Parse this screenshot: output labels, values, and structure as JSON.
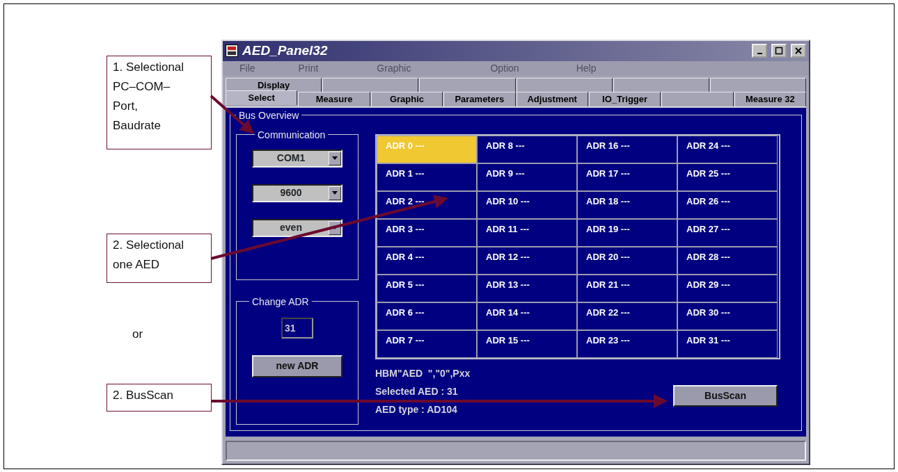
{
  "callouts": [
    {
      "kind": "box",
      "lines": [
        "1. Selectional",
        "PC–COM–",
        "Port,",
        "Baudrate"
      ]
    },
    {
      "kind": "box",
      "lines": [
        "2. Selectional",
        "one AED"
      ]
    },
    {
      "kind": "note",
      "lines": [
        "or"
      ]
    },
    {
      "kind": "box",
      "lines": [
        "2. BusScan"
      ]
    }
  ],
  "window": {
    "title": "AED_Panel32"
  },
  "menu": [
    {
      "label": "File",
      "disabled": true
    },
    {
      "label": "Print",
      "disabled": true
    },
    {
      "label": "Graphic",
      "disabled": true
    },
    {
      "label": "Option",
      "disabled": true
    },
    {
      "label": "Help",
      "disabled": true
    }
  ],
  "tabs_row_1": [
    {
      "kind": "tab",
      "label": "Display",
      "selected": false
    },
    {
      "kind": "blank",
      "selected": false
    },
    {
      "kind": "blank",
      "selected": false
    },
    {
      "kind": "blank",
      "selected": false
    },
    {
      "kind": "blank",
      "selected": false
    },
    {
      "kind": "blank",
      "selected": false
    }
  ],
  "tabs_row_2": [
    {
      "kind": "tab",
      "label": "Select",
      "selected": true
    },
    {
      "kind": "tab",
      "label": "Measure",
      "selected": false
    },
    {
      "kind": "tab",
      "label": "Graphic",
      "selected": false
    },
    {
      "kind": "tab",
      "label": "Parameters",
      "selected": false
    },
    {
      "kind": "tab",
      "label": "Adjustment",
      "selected": false
    },
    {
      "kind": "tab",
      "label": "IO_Trigger",
      "selected": false
    },
    {
      "kind": "blank",
      "selected": false
    },
    {
      "kind": "tab",
      "label": "Measure 32",
      "selected": false
    }
  ],
  "bus_overview": {
    "title": "Bus Overview",
    "communication": {
      "title": "Communication",
      "dropdowns": [
        {
          "value": "COM1"
        },
        {
          "value": "9600"
        },
        {
          "value": "even"
        }
      ]
    },
    "change_adr": {
      "title": "Change ADR",
      "value": "31",
      "button": "new ADR"
    },
    "addresses": [
      {
        "label": "ADR 0 ---",
        "selected": true
      },
      {
        "label": "ADR 1 ---",
        "selected": false
      },
      {
        "label": "ADR 2 ---",
        "selected": false
      },
      {
        "label": "ADR 3 ---",
        "selected": false
      },
      {
        "label": "ADR 4 ---",
        "selected": false
      },
      {
        "label": "ADR 5 ---",
        "selected": false
      },
      {
        "label": "ADR 6 ---",
        "selected": false
      },
      {
        "label": "ADR 7 ---",
        "selected": false
      },
      {
        "label": "ADR 8 ---",
        "selected": false
      },
      {
        "label": "ADR 9 ---",
        "selected": false
      },
      {
        "label": "ADR 10 ---",
        "selected": false
      },
      {
        "label": "ADR 11 ---",
        "selected": false
      },
      {
        "label": "ADR 12 ---",
        "selected": false
      },
      {
        "label": "ADR 13 ---",
        "selected": false
      },
      {
        "label": "ADR 14 ---",
        "selected": false
      },
      {
        "label": "ADR 15 ---",
        "selected": false
      },
      {
        "label": "ADR 16 ---",
        "selected": false
      },
      {
        "label": "ADR 17 ---",
        "selected": false
      },
      {
        "label": "ADR 18 ---",
        "selected": false
      },
      {
        "label": "ADR 19 ---",
        "selected": false
      },
      {
        "label": "ADR 20 ---",
        "selected": false
      },
      {
        "label": "ADR 21 ---",
        "selected": false
      },
      {
        "label": "ADR 22 ---",
        "selected": false
      },
      {
        "label": "ADR 23 ---",
        "selected": false
      },
      {
        "label": "ADR 24 ---",
        "selected": false
      },
      {
        "label": "ADR 25 ---",
        "selected": false
      },
      {
        "label": "ADR 26 ---",
        "selected": false
      },
      {
        "label": "ADR 27 ---",
        "selected": false
      },
      {
        "label": "ADR 28 ---",
        "selected": false
      },
      {
        "label": "ADR 29 ---",
        "selected": false
      },
      {
        "label": "ADR 30 ---",
        "selected": false
      },
      {
        "label": "ADR 31 ---",
        "selected": false
      }
    ],
    "info": [
      "HBM\"AED  \",\"0\",Pxx",
      "Selected AED : 31",
      "AED type : AD104"
    ],
    "button": "BusScan"
  }
}
